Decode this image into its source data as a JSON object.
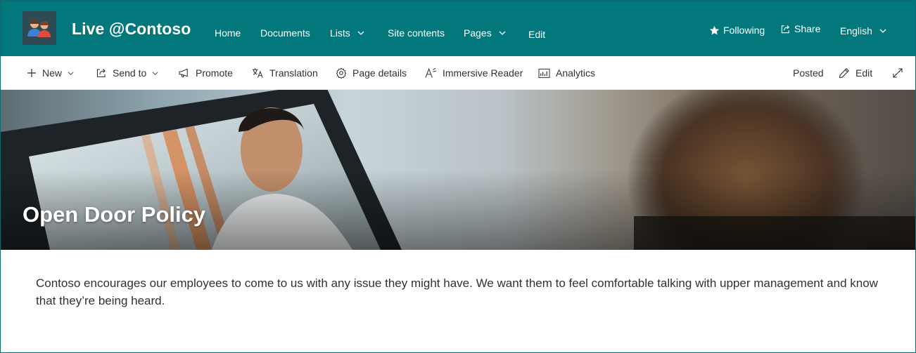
{
  "site": {
    "title": "Live @Contoso",
    "logo": "people-team-logo"
  },
  "topnav": {
    "items": [
      {
        "label": "Home",
        "has_dropdown": false
      },
      {
        "label": "Documents",
        "has_dropdown": false
      },
      {
        "label": "Lists",
        "has_dropdown": true
      },
      {
        "label": "Site contents",
        "has_dropdown": false
      },
      {
        "label": "Pages",
        "has_dropdown": true
      },
      {
        "label": "Edit",
        "has_dropdown": false
      }
    ]
  },
  "header_right": {
    "following_label": "Following",
    "share_label": "Share",
    "language_label": "English"
  },
  "commandbar": {
    "new_label": "New",
    "send_to_label": "Send to",
    "promote_label": "Promote",
    "translation_label": "Translation",
    "page_details_label": "Page details",
    "immersive_reader_label": "Immersive Reader",
    "analytics_label": "Analytics",
    "posted_label": "Posted",
    "edit_label": "Edit"
  },
  "hero": {
    "title": "Open Door Policy"
  },
  "body": {
    "paragraph": "Contoso encourages our employees to come to us with any issue they might have. We want them to feel comfortable talking with upper management and know that they’re being heard."
  },
  "colors": {
    "suite_bar": "#03787c",
    "text": "#323130",
    "white": "#ffffff"
  }
}
